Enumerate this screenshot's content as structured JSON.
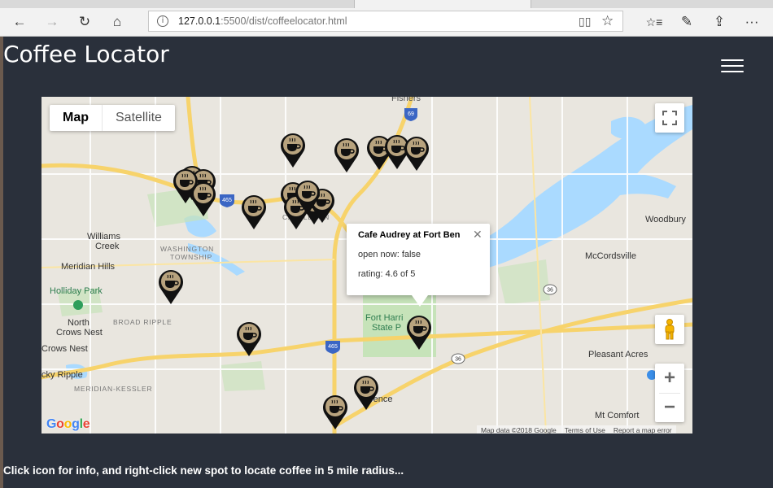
{
  "browser": {
    "back_icon": "←",
    "forward_icon": "→",
    "refresh_icon": "↻",
    "home_icon": "⌂",
    "url_host": "127.0.0.1",
    "url_rest": ":5500/dist/coffeelocator.html",
    "reading_view_icon": "▯▯",
    "favorite_icon": "☆",
    "favorites_hub_icon": "☆≡",
    "notes_icon": "✎",
    "share_icon": "⇪",
    "more_icon": "···"
  },
  "app": {
    "title": "Coffee Locator",
    "footer_hint": "Click icon for info, and right-click new spot to locate coffee in 5 mile radius..."
  },
  "map": {
    "type_options": [
      "Map",
      "Satellite"
    ],
    "selected_type": "Map",
    "places": [
      "Fishers",
      "Williams",
      "Creek",
      "WASHINGTON",
      "TOWNSHIP",
      "Meridian Hills",
      "Holliday Park",
      "North",
      "Crows Nest",
      "BROAD RIPPLE",
      "Crows Nest",
      "cky Ripple",
      "MERIDIAN-KESSLER",
      "CASTLETON",
      "Woodbury",
      "McCordsville",
      "Fort Harri",
      "State P",
      "Pleasant Acres",
      "Mt Comfort",
      "rence"
    ],
    "shields": [
      "69",
      "465",
      "465",
      "36",
      "36"
    ],
    "attribution": [
      "Map data ©2018 Google",
      "Terms of Use",
      "Report a map error"
    ],
    "logo": "Google",
    "info_window": {
      "title": "Cafe Audrey at Fort Ben",
      "open_now": "open now: false",
      "rating": "rating: 4.6 of 5",
      "close_icon": "✕"
    },
    "marker_count": 20,
    "colors": {
      "marker_ring": "#111111",
      "marker_fill": "#b8a37e",
      "park": "#c6e3b9",
      "water": "#aadaff",
      "highway": "#f7d36b",
      "page_bg": "#2a303b"
    }
  }
}
